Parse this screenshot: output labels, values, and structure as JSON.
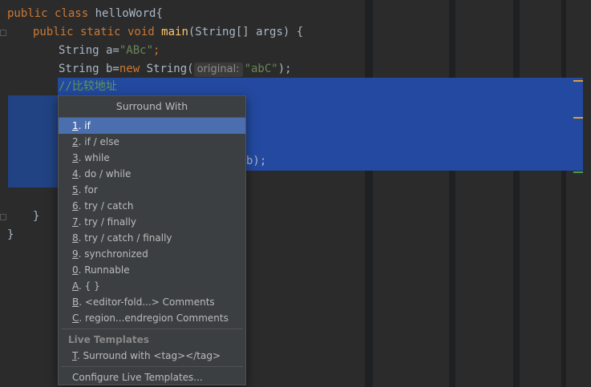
{
  "code": {
    "l1": {
      "kw": "public class ",
      "name": "helloWord",
      "rest": "{"
    },
    "l2": {
      "kw": "public static void ",
      "fn": "main",
      "rest": "(String[] args) {"
    },
    "l3": {
      "a": "String a=",
      "str": "\"ABc\"",
      "end": ";"
    },
    "l4": {
      "a": "String b=",
      "kw": "new",
      "b": " String(",
      "hint": "original:",
      "str": "\"abC\"",
      "end": ");"
    },
    "l5": {
      "cmt": "//比较地址"
    },
    "l9": {
      "tail": "b);"
    },
    "l12": {
      "text": "}"
    },
    "l13": {
      "text": "}"
    }
  },
  "menu": {
    "title": "Surround With",
    "items": [
      {
        "m": "1",
        "rest": ". if"
      },
      {
        "m": "2",
        "rest": ". if / else"
      },
      {
        "m": "3",
        "rest": ". while"
      },
      {
        "m": "4",
        "rest": ". do / while"
      },
      {
        "m": "5",
        "rest": ". for"
      },
      {
        "m": "6",
        "rest": ". try / catch"
      },
      {
        "m": "7",
        "rest": ". try / finally"
      },
      {
        "m": "8",
        "rest": ". try / catch / finally"
      },
      {
        "m": "9",
        "rest": ". synchronized"
      },
      {
        "m": "0",
        "rest": ". Runnable"
      },
      {
        "m": "A",
        "rest": ". { }"
      },
      {
        "m": "B",
        "rest": ". <editor-fold...> Comments"
      },
      {
        "m": "C",
        "rest": ". region...endregion Comments"
      }
    ],
    "section": "Live Templates",
    "tag_item": {
      "m": "T",
      "rest": ". Surround with <tag></tag>"
    },
    "configure": "Configure Live Templates..."
  },
  "colors": {
    "selection": "#214283",
    "menu_bg": "#3c3f41",
    "menu_active": "#4b6eaf",
    "keyword": "#cc7832",
    "string": "#6a8759",
    "comment": "#629755"
  }
}
